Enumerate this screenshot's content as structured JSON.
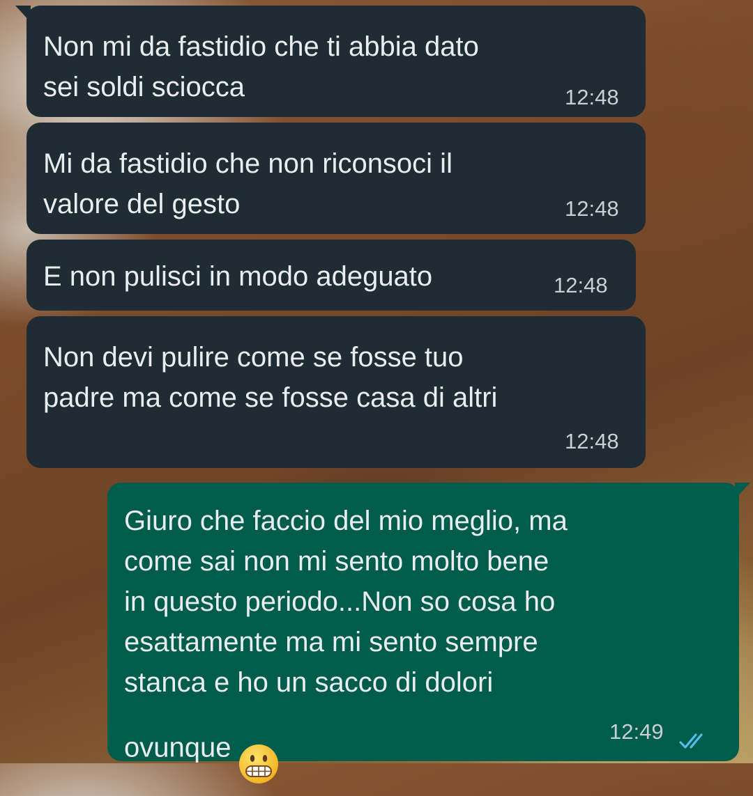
{
  "messages": [
    {
      "direction": "incoming",
      "text": "Non mi da fastidio che ti abbia dato\nsei soldi sciocca",
      "time": "12:48"
    },
    {
      "direction": "incoming",
      "text": "Mi da fastidio che non riconsoci il\nvalore del gesto",
      "time": "12:48"
    },
    {
      "direction": "incoming",
      "text": "E non pulisci in modo adeguato",
      "time": "12:48"
    },
    {
      "direction": "incoming",
      "text": "Non devi pulire come se fosse tuo\npadre ma come se fosse casa di altri",
      "time": "12:48"
    },
    {
      "direction": "outgoing",
      "text": "Giuro che faccio del mio meglio, ma\ncome sai non mi sento molto bene\nin questo periodo...Non so cosa ho\nesattamente ma mi sento sempre\nstanca e ho un sacco di dolori\novunque",
      "emoji": "grimacing-face-emoji",
      "time": "12:49",
      "status": "read-double-check-icon"
    }
  ],
  "colors": {
    "incoming_bubble": "#1f2c34",
    "outgoing_bubble": "#005c4b",
    "text": "#e9edef",
    "timestamp": "#c7d0d4",
    "read_ticks": "#53bdeb"
  }
}
